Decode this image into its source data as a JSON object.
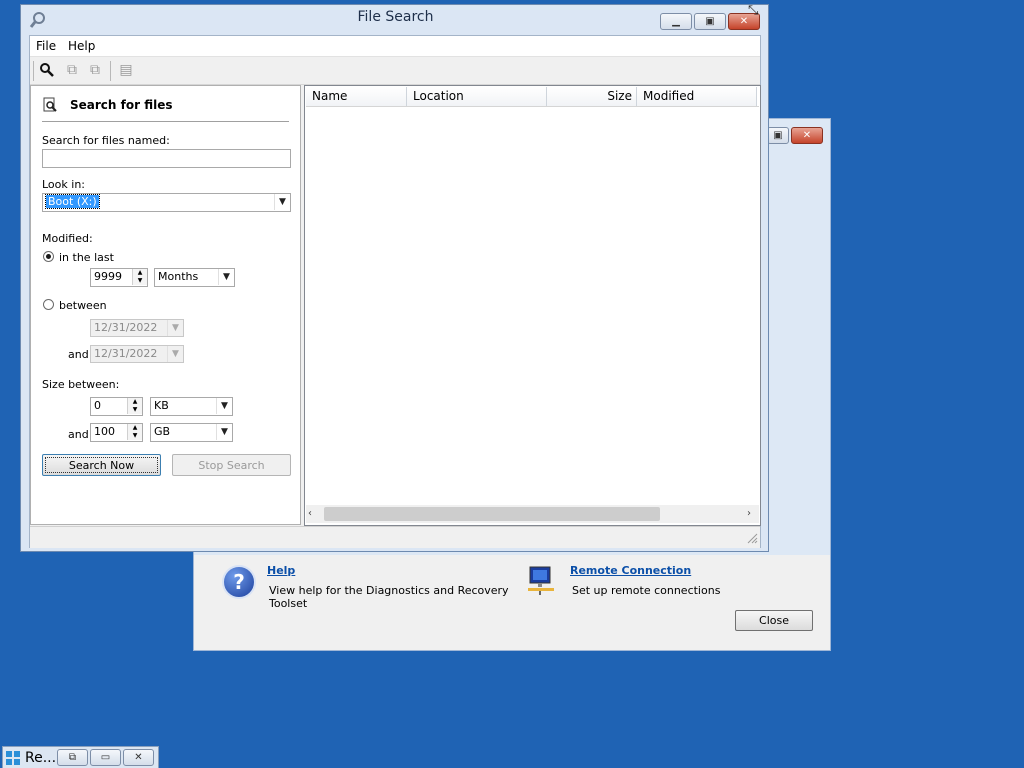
{
  "main_window": {
    "title": "File Search",
    "menu": [
      "File",
      "Help"
    ],
    "search_panel": {
      "heading": "Search for files",
      "named_label": "Search for files named:",
      "named_value": "",
      "look_in_label": "Look in:",
      "look_in_value": "Boot (X:)",
      "modified_label": "Modified:",
      "in_last_label": "in the last",
      "in_last_selected": true,
      "in_last_value": "9999",
      "in_last_unit": "Months",
      "between_label": "between",
      "between_selected": false,
      "date_from": "12/31/2022",
      "and_label": "and",
      "date_to": "12/31/2022",
      "size_label": "Size between:",
      "size_min": "0",
      "size_min_unit": "KB",
      "size_max": "100",
      "size_max_unit": "GB",
      "search_button": "Search Now",
      "stop_button": "Stop Search"
    },
    "results": {
      "columns": [
        "Name",
        "Location",
        "Size",
        "Modified"
      ]
    }
  },
  "background_window": {
    "help_title": "Help",
    "help_desc_line1": "View help for the Diagnostics and Recovery",
    "help_desc_line2": "Toolset",
    "remote_title": "Remote Connection",
    "remote_desc": "Set up remote connections",
    "close_button": "Close"
  },
  "taskbar": {
    "label": "Re..."
  },
  "colors": {
    "desktop": "#1f63b4",
    "selection": "#3399ff",
    "link": "#0b4fa8"
  }
}
